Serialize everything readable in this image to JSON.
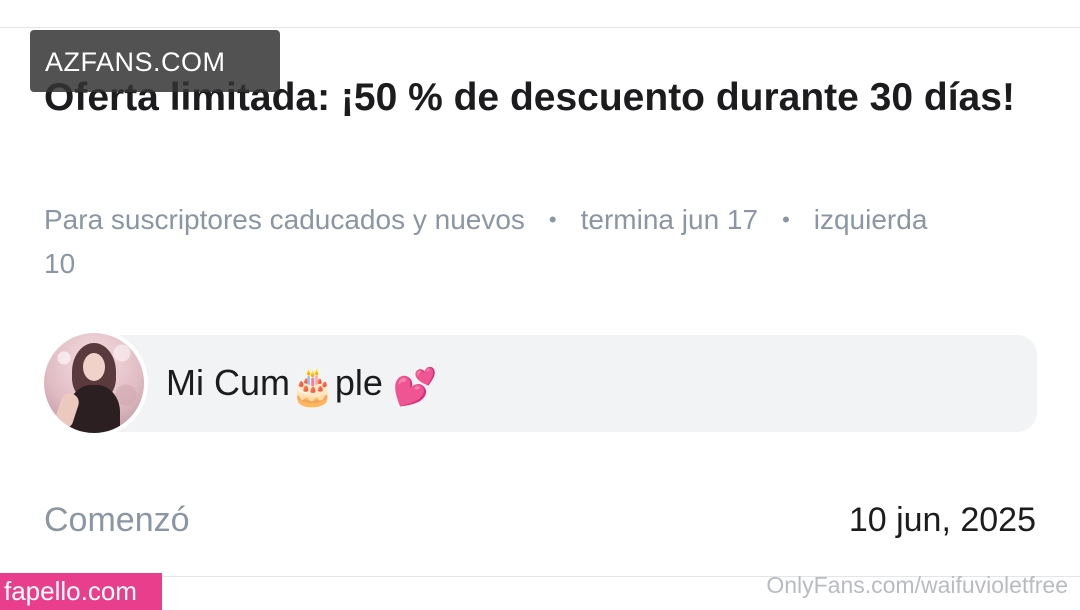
{
  "watermarks": {
    "top_left": "AZFANS.COM",
    "bottom_left": "fapello.com",
    "bottom_right": "OnlyFans.com/waifuvioletfree"
  },
  "offer": {
    "title": "Oferta limitada: ¡50 % de descuento durante 30 días!",
    "audience": "Para suscriptores caducados y nuevos",
    "separator": "•",
    "ends": "termina jun 17",
    "remaining": "izquierda 10"
  },
  "message": {
    "text_part1": "Mi Cum",
    "emoji_cake": "🎂",
    "text_part2": "ple ",
    "emoji_hearts": "💕",
    "avatar_icon": "user-avatar-photo"
  },
  "details": {
    "started_label": "Comenzó",
    "started_date": "10 jun, 2025"
  },
  "colors": {
    "muted_text": "#8a96a3",
    "primary_text": "#1c1c1e",
    "bubble_bg": "#f1f3f5",
    "watermark_pink": "#e83e8c"
  }
}
